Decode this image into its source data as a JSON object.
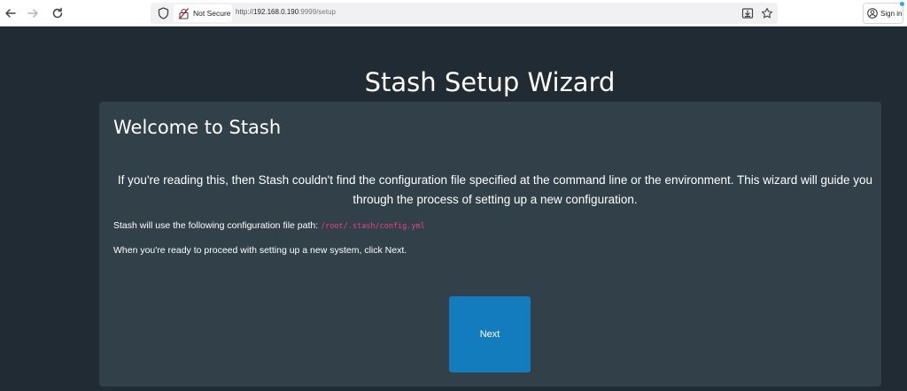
{
  "browser": {
    "security_label": "Not Secure",
    "url_prefix": "http://",
    "url_host": "192.168.0.190",
    "url_path": ":9999/setup",
    "signin_label": "Sign in",
    "icons": {
      "back": "arrow-left-icon",
      "forward": "arrow-right-icon",
      "reload": "reload-icon",
      "shield": "shield-icon",
      "lock": "lock-slash-icon",
      "install": "install-app-icon",
      "star": "star-icon",
      "account": "account-icon"
    }
  },
  "page": {
    "title": "Stash Setup Wizard",
    "card": {
      "heading": "Welcome to Stash",
      "intro": "If you're reading this, then Stash couldn't find the configuration file specified at the command line or the environment. This wizard will guide you through the process of setting up a new configuration.",
      "path_text": "Stash will use the following configuration file path:",
      "config_path": "/root/.stash/config.yml",
      "ready_text": "When you're ready to proceed with setting up a new system, click Next.",
      "next_label": "Next"
    }
  },
  "colors": {
    "page_bg": "#202b33",
    "card_bg": "#324049",
    "primary_button": "#137cbd",
    "code_text": "#e8457c"
  }
}
